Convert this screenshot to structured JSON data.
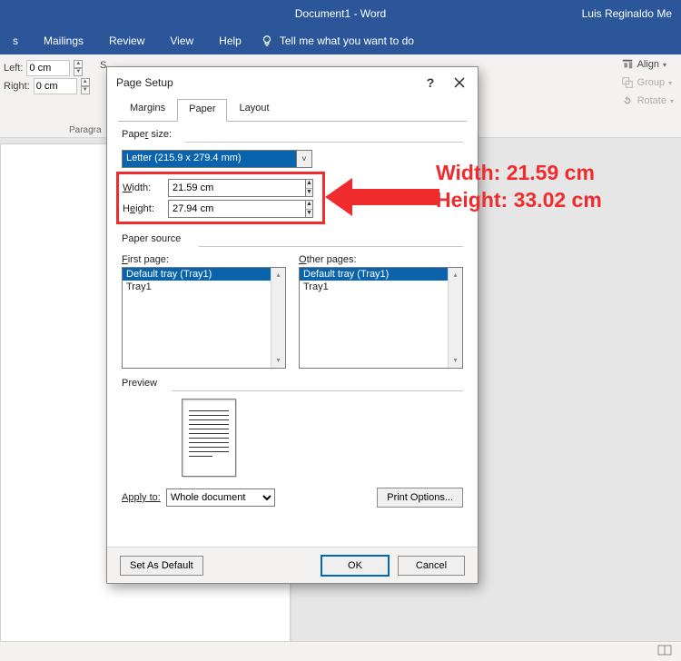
{
  "window": {
    "title": "Document1  -  Word",
    "user": "Luis Reginaldo Me"
  },
  "ribbon_tabs": {
    "t0": "s",
    "t1": "Mailings",
    "t2": "Review",
    "t3": "View",
    "t4": "Help",
    "tellme": "Tell me what you want to do"
  },
  "ribbon": {
    "left_label": "Left:",
    "left_value": "0 cm",
    "right_label": "Right:",
    "right_value": "0 cm",
    "s_label": "S",
    "group_label": "Paragra",
    "align": "Align",
    "group": "Group",
    "rotate": "Rotate"
  },
  "dialog": {
    "title": "Page Setup",
    "tabs": {
      "margins": "Margins",
      "paper": "Paper",
      "layout": "Layout"
    },
    "paper_size_label": "Paper size:",
    "paper_size_value": "Letter (215.9 x 279.4 mm)",
    "width_label": "Width:",
    "width_value": "21.59 cm",
    "height_label": "Height:",
    "height_value": "27.94 cm",
    "paper_source_label": "Paper source",
    "first_page_label": "First page:",
    "other_pages_label": "Other pages:",
    "tray_default": "Default tray (Tray1)",
    "tray1": "Tray1",
    "preview_label": "Preview",
    "apply_to_label": "Apply to:",
    "apply_to_value": "Whole document",
    "print_options": "Print Options...",
    "set_default": "Set As Default",
    "ok": "OK",
    "cancel": "Cancel"
  },
  "annotation": {
    "line1": "Width: 21.59 cm",
    "line2": "Height: 33.02 cm"
  }
}
